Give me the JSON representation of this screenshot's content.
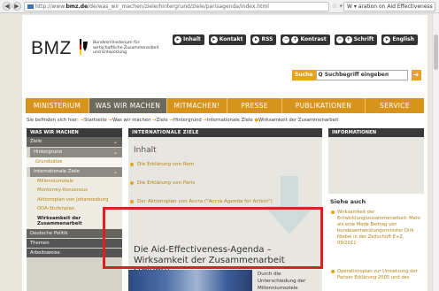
{
  "browser": {
    "back": "◀",
    "forward": "▶",
    "url_prefix": "http://www.",
    "url_host": "bmz.de",
    "url_path": "/de/was_wir_machen/ziele/hintergrund/ziele/parisagenda/index.html",
    "url_tail": "☆ ▾ C",
    "search_value": "W ▾ aration on Aid Effectiveness 2005 🔎"
  },
  "header": {
    "logo": "BMZ",
    "ministry": "Bundesministerium für wirtschaftliche Zusammenarbeit und Entwicklung",
    "links": [
      {
        "icon": "▸",
        "label": "Inhalt"
      },
      {
        "icon": "▸",
        "label": "Kontakt"
      },
      {
        "icon": "▸",
        "label": "RSS"
      },
      {
        "icon": "−",
        "label": ""
      },
      {
        "icon": "+",
        "label": "Kontrast"
      },
      {
        "icon": "−",
        "label": ""
      },
      {
        "icon": "+",
        "label": "Schrift"
      },
      {
        "icon": "▸",
        "label": "English"
      }
    ],
    "search_label": "Suche",
    "search_placeholder": "Q Suchbegriff eingeben",
    "search_go": "➔"
  },
  "mainnav": [
    "MINISTERIUM",
    "WAS WIR MACHEN",
    "MITMACHEN!",
    "PRESSE",
    "PUBLIKATIONEN",
    "SERVICE"
  ],
  "breadcrumb": {
    "prefix": "Sie befinden sich hier:",
    "items": [
      "Startseite",
      "Was wir machen",
      "Ziele",
      "Hintergrund",
      "Internationale Ziele"
    ],
    "current": "Wirksamkeit der Zusammenarbeit"
  },
  "sidebar": {
    "head": "WAS WIR MACHEN",
    "l1": "Ziele",
    "l2": "Hintergrund",
    "l3a": "Grundsätze",
    "l2b": "Internationale Ziele",
    "l3": [
      "Millenniumziele",
      "Monterrey-Konsensus",
      "Aktionsplan von Johannesburg",
      "ODA-Stufenplan",
      "Wirksamkeit der Zusammenarbeit"
    ],
    "l1b": "Deutsche Politik",
    "l0": [
      "Themen",
      "Arbeitsweise"
    ]
  },
  "content": {
    "head": "INTERNATIONALE ZIELE",
    "toc_title": "Inhalt",
    "toc": [
      "Die Erklärung von Rom",
      "Die Erklärung von Paris",
      "Der Aktionsplan von Accra (\"Accra Agenda for Action\")"
    ],
    "title": "Die Aid-Effectiveness-Agenda – Wirksamkeit der Zusammenarbeit steigern",
    "teaser": "Durch die Unterschiedung der Millenniumsziele"
  },
  "infobox": {
    "head": "INFORMATIONEN",
    "label": "Siehe auch",
    "links": [
      "Wirksamkeit der Entwicklungszusammenarbeit: Mehr als eine Mode Beitrag von bundesentwicklungsminister Dirk Niebel in der Zeitschrift E+Z, 09/2011",
      "Operationsplan zur Umsetzung der Pariser Erklärung 2005 und des"
    ]
  }
}
